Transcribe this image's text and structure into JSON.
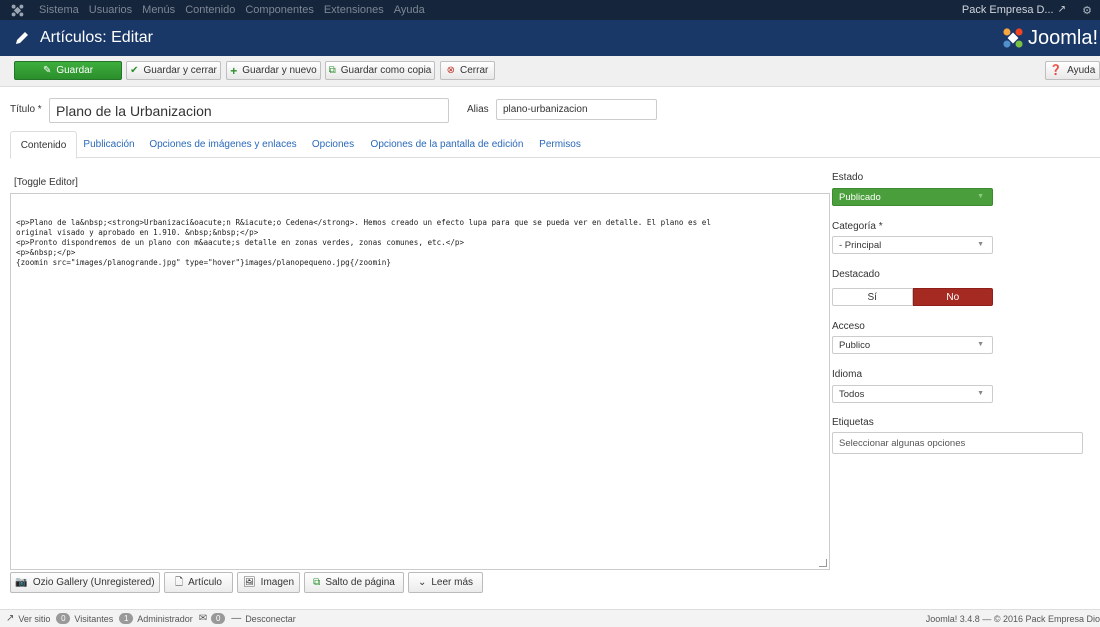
{
  "topnav": {
    "menu": [
      "Sistema",
      "Usuarios",
      "Menús",
      "Contenido",
      "Componentes",
      "Extensiones",
      "Ayuda"
    ],
    "site_name": "Pack Empresa D...",
    "site_icon": "external-link-icon",
    "settings_icon": "gear-icon"
  },
  "header": {
    "title": "Artículos: Editar",
    "brand": "Joomla!"
  },
  "toolbar": {
    "save": "Guardar",
    "save_close": "Guardar y cerrar",
    "save_new": "Guardar y nuevo",
    "save_copy": "Guardar como copia",
    "close": "Cerrar",
    "help": "Ayuda"
  },
  "form": {
    "title_label": "Título *",
    "title_value": "Plano de la Urbanizacion",
    "alias_label": "Alias",
    "alias_value": "plano-urbanizacion"
  },
  "tabs": [
    "Contenido",
    "Publicación",
    "Opciones de imágenes y enlaces",
    "Opciones",
    "Opciones de la pantalla de edición",
    "Permisos"
  ],
  "editor": {
    "toggle": "[Toggle Editor]",
    "content": "<p>Plano de la&nbsp;<strong>Urbanizaci&oacute;n R&iacute;o Cedena</strong>. Hemos creado un efecto lupa para que se pueda ver en detalle. El plano es el\noriginal visado y aprobado en 1.910. &nbsp;&nbsp;</p>\n<p>Pronto dispondremos de un plano con m&aacute;s detalle en zonas verdes, zonas comunes, etc.</p>\n<p>&nbsp;</p>\n{zoomin src=\"images/planogrande.jpg\" type=\"hover\"}images/planopequeno.jpg{/zoomin}"
  },
  "editor_buttons": {
    "ozio": "Ozio Gallery (Unregistered)",
    "article": "Artículo",
    "image": "Imagen",
    "pagebreak": "Salto de página",
    "readmore": "Leer más"
  },
  "sidebar": {
    "state_label": "Estado",
    "state_value": "Publicado",
    "category_label": "Categoría *",
    "category_value": "- Principal",
    "featured_label": "Destacado",
    "featured_yes": "Sí",
    "featured_no": "No",
    "access_label": "Acceso",
    "access_value": "Publico",
    "language_label": "Idioma",
    "language_value": "Todos",
    "tags_label": "Etiquetas",
    "tags_placeholder": "Seleccionar algunas opciones"
  },
  "status": {
    "view_site": "Ver sitio",
    "visitors_count": "0",
    "visitors_label": "Visitantes",
    "admin_count": "1",
    "admin_label": "Administrador",
    "messages_count": "0",
    "logout": "Desconectar",
    "footer": "Joomla! 3.4.8 — © 2016 Pack Empresa Dio"
  },
  "colors": {
    "topnav_bg": "#15253c",
    "header_bg": "#1a3867",
    "green": "#3cae3c",
    "red": "#a52a22",
    "link": "#2a69b8"
  }
}
